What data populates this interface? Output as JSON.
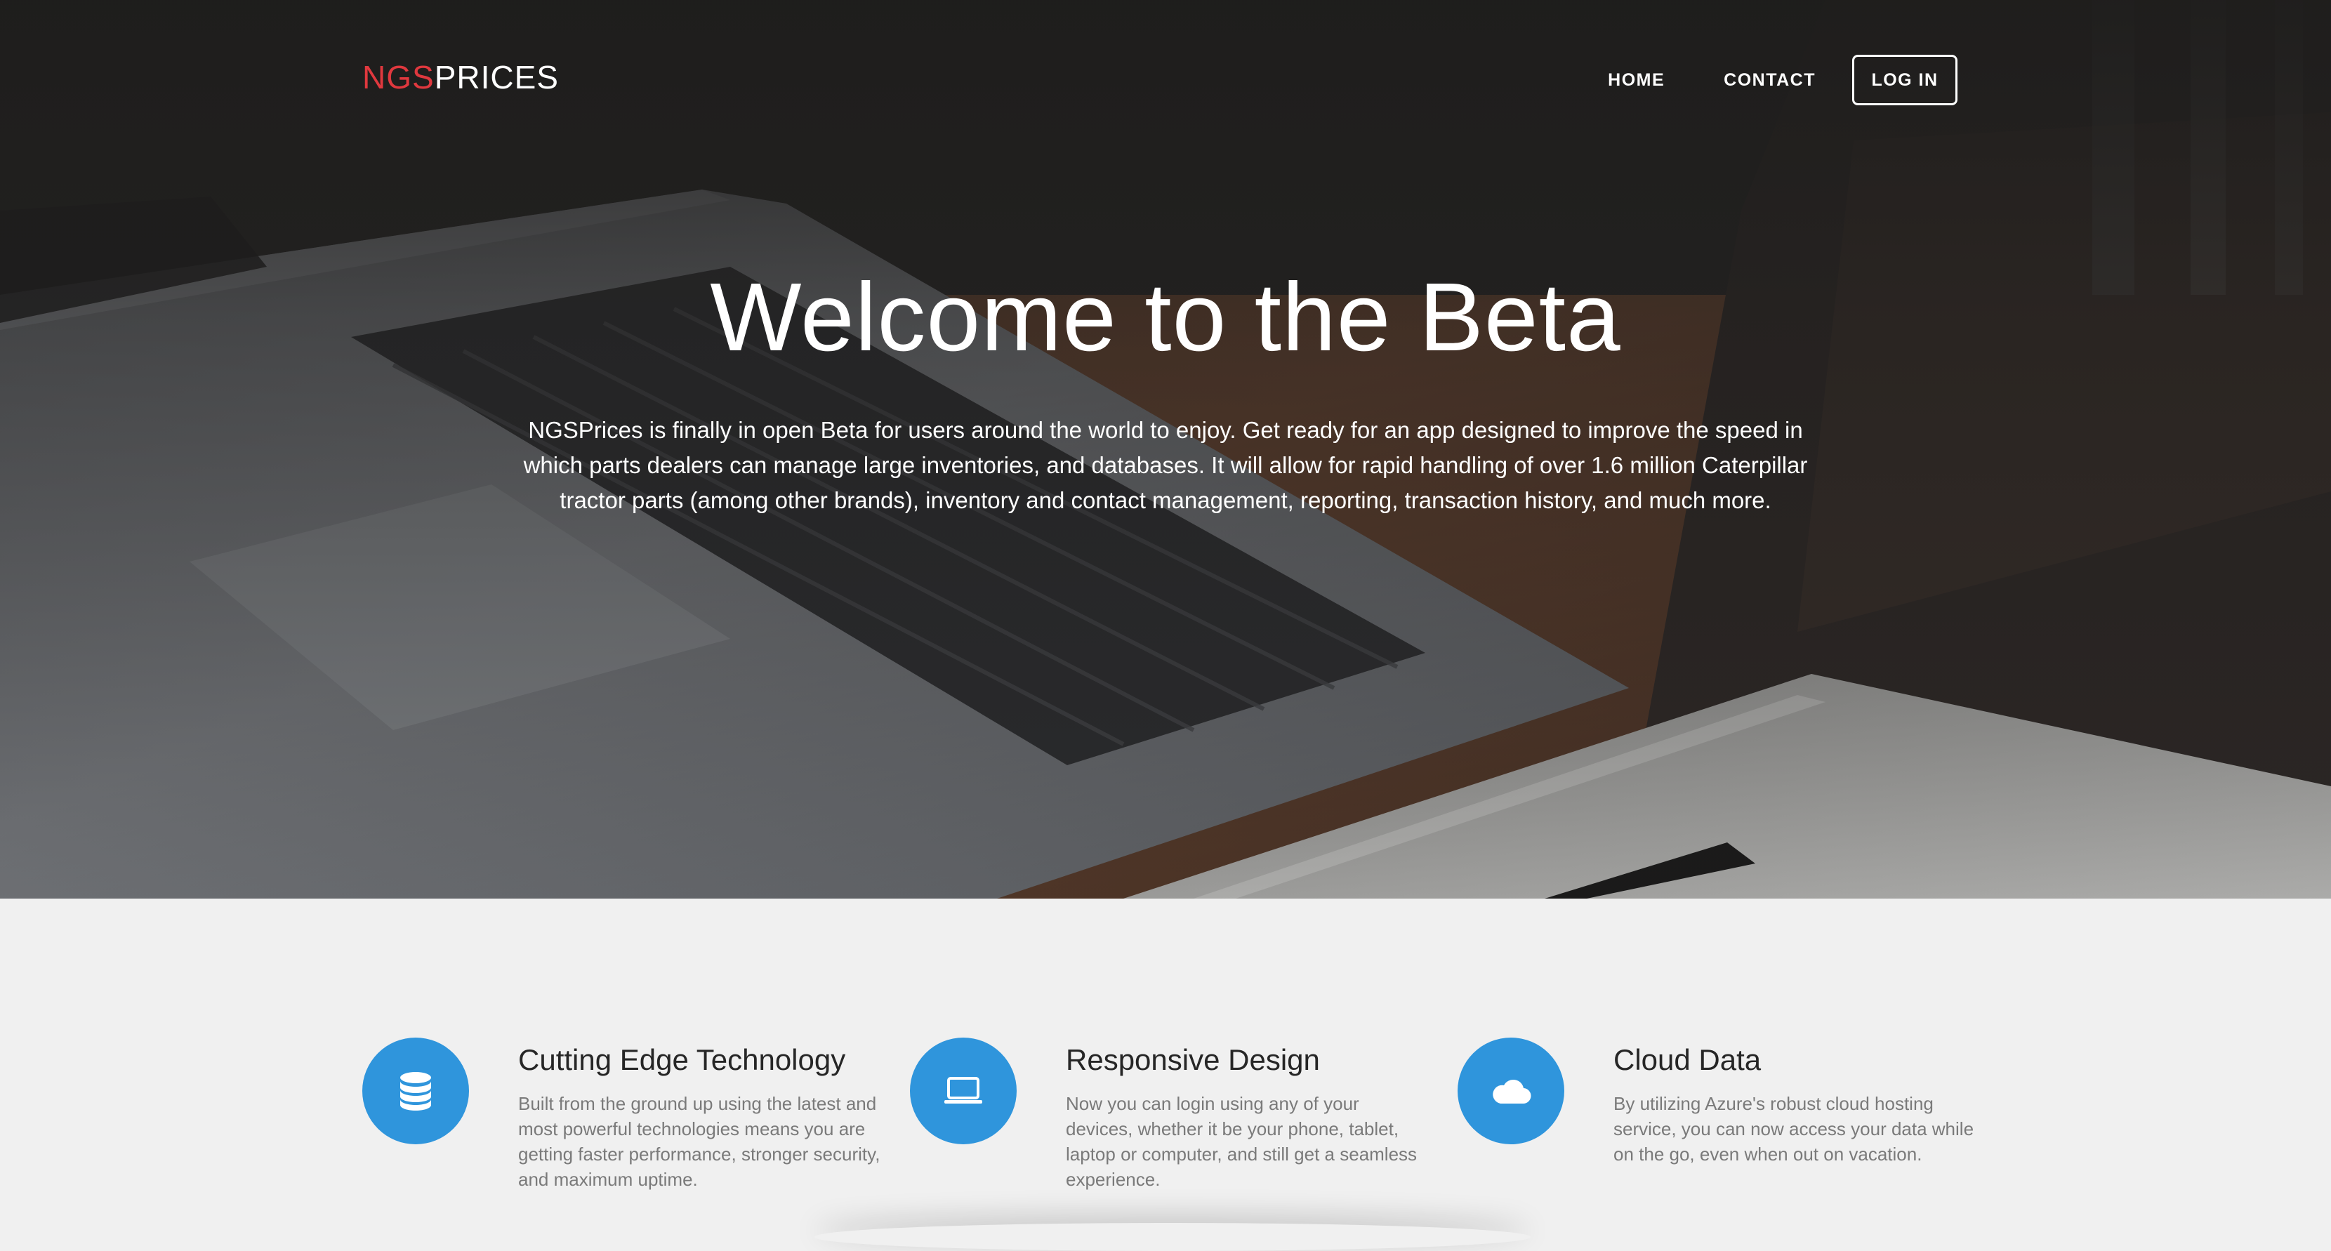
{
  "nav": {
    "logo_accent": "NGS",
    "logo_rest": "PRICES",
    "links": [
      "HOME",
      "CONTACT"
    ],
    "login_label": "LOG IN"
  },
  "hero": {
    "title": "Welcome to the Beta",
    "text": "NGSPrices is finally in open Beta for users around the world to enjoy. Get ready for an app designed to improve the speed in which parts dealers can manage large inventories, and databases. It will allow for rapid handling of over 1.6 million Caterpillar tractor parts (among other brands), inventory and contact management, reporting, transaction history, and much more."
  },
  "features": [
    {
      "icon": "database-icon",
      "title": "Cutting Edge Technology",
      "text": "Built from the ground up using the latest and most powerful technologies means you are getting faster performance, stronger security, and maximum uptime."
    },
    {
      "icon": "laptop-icon",
      "title": "Responsive Design",
      "text": "Now you can login using any of your devices, whether it be your phone, tablet, laptop or computer, and still get a seamless experience."
    },
    {
      "icon": "cloud-icon",
      "title": "Cloud Data",
      "text": "By utilizing Azure's robust cloud hosting service, you can now access your data while on the go, even when out on vacation."
    }
  ],
  "colors": {
    "logo_accent": "#e0383e",
    "icon_circle": "#2f95dc",
    "features_bg": "#f0f0f0"
  }
}
